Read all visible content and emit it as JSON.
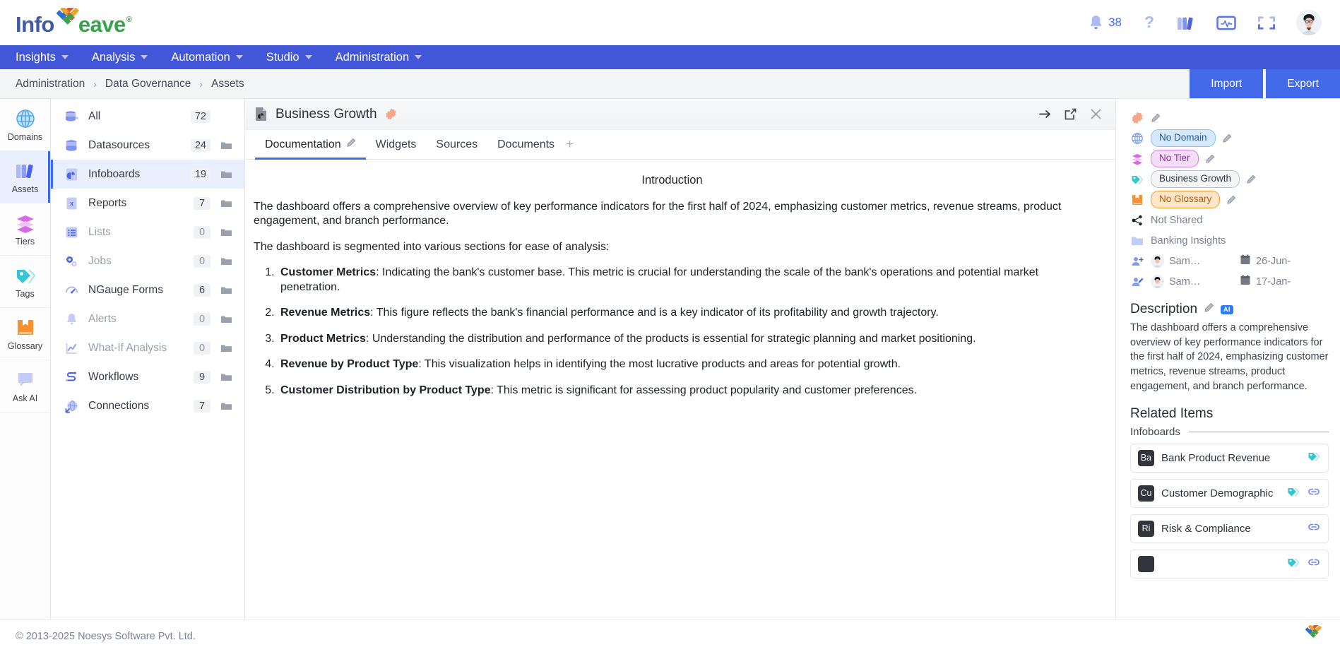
{
  "brand": {
    "logo_info": "Info",
    "logo_eave": "eave",
    "logo_registered": "®",
    "logo_mark_icon": "weave-diamond-icon",
    "icons": {
      "notifications": "bell-icon",
      "notification_count": "38",
      "help": "question-mark-icon",
      "library": "books-icon",
      "monitor": "monitor-pulse-icon",
      "fullscreen": "fullscreen-icon",
      "avatar": "user-avatar"
    }
  },
  "nav": {
    "items": [
      {
        "label": "Insights",
        "caret": "chevron-down-icon"
      },
      {
        "label": "Analysis",
        "caret": "chevron-down-icon"
      },
      {
        "label": "Automation",
        "caret": "chevron-down-icon"
      },
      {
        "label": "Studio",
        "caret": "chevron-down-icon"
      },
      {
        "label": "Administration",
        "caret": "chevron-down-icon"
      }
    ]
  },
  "breadcrumb": {
    "items": [
      "Administration",
      "Data Governance",
      "Assets"
    ],
    "separator": "›",
    "import_label": "Import",
    "export_label": "Export"
  },
  "rail": {
    "items": [
      {
        "label": "Domains",
        "icon": "globe-icon",
        "active": false
      },
      {
        "label": "Assets",
        "icon": "books-icon",
        "active": true
      },
      {
        "label": "Tiers",
        "icon": "layers-icon",
        "active": false
      },
      {
        "label": "Tags",
        "icon": "tag-icon",
        "active": false
      },
      {
        "label": "Glossary",
        "icon": "book-icon",
        "active": false
      },
      {
        "label": "Ask AI",
        "icon": "chat-bubble-icon",
        "active": false
      }
    ]
  },
  "asset_list": {
    "rows": [
      {
        "label": "All",
        "count": "72",
        "icon": "database-all-icon",
        "selected": false,
        "muted": false,
        "folder": false
      },
      {
        "label": "Datasources",
        "count": "24",
        "icon": "database-icon",
        "selected": false,
        "muted": false,
        "folder": true
      },
      {
        "label": "Infoboards",
        "count": "19",
        "icon": "infoboard-icon",
        "selected": true,
        "muted": false,
        "folder": true
      },
      {
        "label": "Reports",
        "count": "7",
        "icon": "report-icon",
        "selected": false,
        "muted": false,
        "folder": true
      },
      {
        "label": "Lists",
        "count": "0",
        "icon": "list-icon",
        "selected": false,
        "muted": true,
        "folder": true
      },
      {
        "label": "Jobs",
        "count": "0",
        "icon": "gears-icon",
        "selected": false,
        "muted": true,
        "folder": true
      },
      {
        "label": "NGauge Forms",
        "count": "6",
        "icon": "gauge-icon",
        "selected": false,
        "muted": false,
        "folder": true
      },
      {
        "label": "Alerts",
        "count": "0",
        "icon": "bell-icon",
        "selected": false,
        "muted": true,
        "folder": true
      },
      {
        "label": "What-If Analysis",
        "count": "0",
        "icon": "line-chart-icon",
        "selected": false,
        "muted": true,
        "folder": true
      },
      {
        "label": "Workflows",
        "count": "9",
        "icon": "workflow-icon",
        "selected": false,
        "muted": false,
        "folder": true
      },
      {
        "label": "Connections",
        "count": "7",
        "icon": "connections-icon",
        "selected": false,
        "muted": false,
        "folder": true
      }
    ]
  },
  "main": {
    "title": "Business Growth",
    "title_icon": "infoboard-file-icon",
    "title_badge_icon": "orange-blob-icon",
    "actions": [
      {
        "name": "expand-right-icon"
      },
      {
        "name": "open-external-icon"
      },
      {
        "name": "close-icon"
      }
    ],
    "tabs": [
      {
        "label": "Documentation",
        "active": true,
        "edit_icon": "pencil-icon"
      },
      {
        "label": "Widgets",
        "active": false,
        "edit_icon": ""
      },
      {
        "label": "Sources",
        "active": false,
        "edit_icon": ""
      },
      {
        "label": "Documents",
        "active": false,
        "edit_icon": ""
      }
    ],
    "tab_add": "+",
    "doc": {
      "heading": "Introduction",
      "paragraph1": "The dashboard offers a comprehensive overview of key performance indicators for the first half of 2024, emphasizing customer metrics, revenue streams, product engagement, and branch performance.",
      "paragraph2": "The dashboard is segmented into various sections for ease of analysis:",
      "list": [
        {
          "term": "Customer Metrics",
          "text": ": Indicating the bank's customer base. This metric is crucial for understanding the scale of the bank's operations and potential market penetration."
        },
        {
          "term": "Revenue Metrics",
          "text": ": This figure reflects the bank's financial performance and is a key indicator of its profitability and growth trajectory."
        },
        {
          "term": "Product Metrics",
          "text": ": Understanding the distribution and performance of the products is essential for strategic planning and market positioning."
        },
        {
          "term": "Revenue by Product Type",
          "text": ": This visualization helps in identifying the most lucrative products and areas for potential growth."
        },
        {
          "term": "Customer Distribution by Product Type",
          "text": ": This metric is significant for assessing product popularity and customer preferences."
        }
      ]
    }
  },
  "right": {
    "blob_icon": "orange-blob-icon",
    "meta": [
      {
        "icon": "globe-icon",
        "pill": "No Domain",
        "pill_style": "domain",
        "editable": true
      },
      {
        "icon": "layers-icon",
        "pill": "No Tier",
        "pill_style": "tier",
        "editable": true
      },
      {
        "icon": "tag-icon",
        "pill": "Business Growth",
        "pill_style": "tag",
        "editable": true
      },
      {
        "icon": "book-icon",
        "pill": "No Glossary",
        "pill_style": "glossary",
        "editable": true
      }
    ],
    "shared": {
      "icon": "share-icon",
      "label": "Not Shared"
    },
    "folder": {
      "icon": "folder-icon",
      "label": "Banking Insights"
    },
    "created": {
      "icon": "user-plus-icon",
      "user": "Sam…",
      "date_icon": "calendar-icon",
      "date": "26-Jun-"
    },
    "modified": {
      "icon": "user-edit-icon",
      "user": "Sam…",
      "date_icon": "calendar-icon",
      "date": "17-Jan-"
    },
    "description": {
      "title": "Description",
      "edit_icon": "pencil-icon",
      "ai_badge": "AI",
      "text": "The dashboard offers a comprehensive overview of key performance indicators for the first half of 2024, emphasizing customer metrics, revenue streams, product engagement, and branch performance."
    },
    "related": {
      "title": "Related Items",
      "group_label": "Infoboards",
      "items": [
        {
          "abbr": "Ba",
          "name": "Bank Product Revenue",
          "has_tag": true,
          "has_link": false
        },
        {
          "abbr": "Cu",
          "name": "Customer Demographic",
          "has_tag": true,
          "has_link": true
        },
        {
          "abbr": "Ri",
          "name": "Risk & Compliance",
          "has_tag": false,
          "has_link": true
        },
        {
          "abbr": "",
          "name": "",
          "has_tag": true,
          "has_link": true
        }
      ]
    }
  },
  "footer": {
    "copyright": "© 2013-2025 Noesys Software Pvt. Ltd.",
    "logo_icon": "weave-diamond-icon"
  },
  "colors": {
    "nav_blue": "#4157d8",
    "accent_blue": "#4169e8",
    "green": "#38a24a",
    "orange": "#f09c35"
  }
}
